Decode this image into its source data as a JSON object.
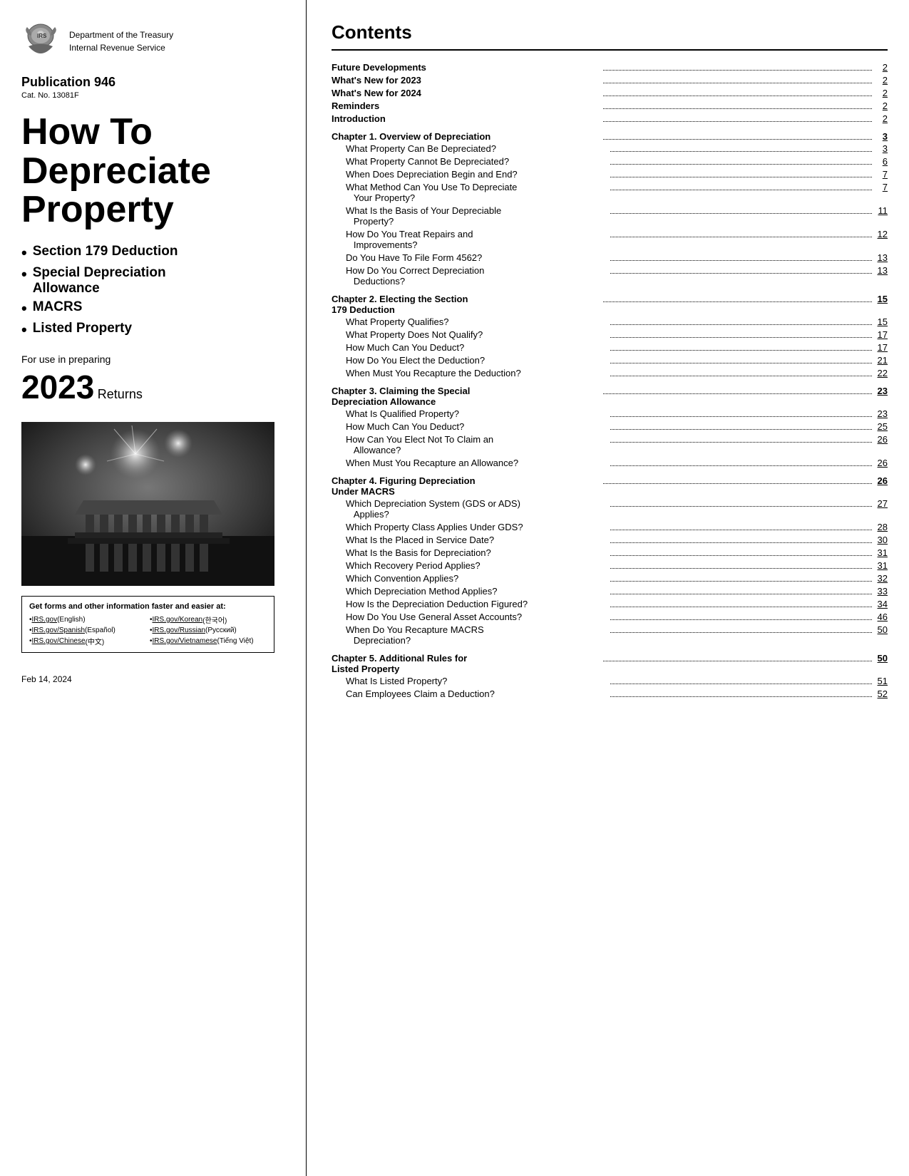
{
  "left": {
    "irs_dept": "Department of the Treasury",
    "irs_service": "Internal Revenue Service",
    "publication_label": "Publication 946",
    "cat_number": "Cat. No. 13081F",
    "main_title_line1": "How To",
    "main_title_line2": "Depreciate",
    "main_title_line3": "Property",
    "bullets": [
      "Section 179 Deduction",
      "Special Depreciation Allowance",
      "MACRS",
      "Listed Property"
    ],
    "for_use_text": "For use in preparing",
    "year": "2023",
    "returns_label": "Returns",
    "get_forms_title": "Get forms and other information faster and easier at:",
    "links": [
      {
        "label": "IRS.gov",
        "lang": "(English)"
      },
      {
        "label": "IRS.gov/Korean",
        "lang": "(한국어)"
      },
      {
        "label": "IRS.gov/Spanish",
        "lang": "(Español)"
      },
      {
        "label": "IRS.gov/Russian",
        "lang": "(Русский)"
      },
      {
        "label": "IRS.gov/Chinese",
        "lang": "(中文)"
      },
      {
        "label": "IRS.gov/Vietnamese",
        "lang": "(Tiếng Việt)"
      }
    ],
    "date_footer": "Feb 14, 2024"
  },
  "right": {
    "contents_title": "Contents",
    "toc": [
      {
        "text": "Future Developments",
        "dots": true,
        "page": "2",
        "bold": true,
        "indent": 0
      },
      {
        "text": "What's New for 2023",
        "dots": true,
        "page": "2",
        "bold": true,
        "indent": 0
      },
      {
        "text": "What's New for 2024",
        "dots": true,
        "page": "2",
        "bold": true,
        "indent": 0
      },
      {
        "text": "Reminders",
        "dots": true,
        "page": "2",
        "bold": true,
        "indent": 0
      },
      {
        "text": "Introduction",
        "dots": true,
        "page": "2",
        "bold": true,
        "indent": 0
      },
      {
        "chapter": "Chapter 1. Overview of Depreciation",
        "dots": true,
        "page": "3"
      },
      {
        "text": "What Property Can Be Depreciated?",
        "dots": true,
        "page": "3",
        "indent": 1
      },
      {
        "text": "What Property Cannot Be Depreciated?",
        "dots": true,
        "page": "6",
        "indent": 1
      },
      {
        "text": "When Does Depreciation Begin and End?",
        "dots": true,
        "page": "7",
        "indent": 1
      },
      {
        "text": "What Method Can You Use To Depreciate Your Property?",
        "dots": true,
        "page": "7",
        "indent": 1,
        "multiline": true
      },
      {
        "text": "What Is the Basis of Your Depreciable Property?",
        "dots": true,
        "page": "11",
        "indent": 1,
        "multiline": true
      },
      {
        "text": "How Do You Treat Repairs and Improvements?",
        "dots": true,
        "page": "12",
        "indent": 1,
        "multiline": true
      },
      {
        "text": "Do You Have To File Form 4562?",
        "dots": true,
        "page": "13",
        "indent": 1
      },
      {
        "text": "How Do You Correct Depreciation Deductions?",
        "dots": true,
        "page": "13",
        "indent": 1,
        "multiline": true
      },
      {
        "chapter": "Chapter 2. Electing the Section 179 Deduction",
        "dots": true,
        "page": "15"
      },
      {
        "text": "What Property Qualifies?",
        "dots": true,
        "page": "15",
        "indent": 1
      },
      {
        "text": "What Property Does Not Qualify?",
        "dots": true,
        "page": "17",
        "indent": 1
      },
      {
        "text": "How Much Can You Deduct?",
        "dots": true,
        "page": "17",
        "indent": 1
      },
      {
        "text": "How Do You Elect the Deduction?",
        "dots": true,
        "page": "21",
        "indent": 1
      },
      {
        "text": "When Must You Recapture the Deduction?",
        "dots": true,
        "page": "22",
        "indent": 1
      },
      {
        "chapter": "Chapter 3. Claiming the Special Depreciation Allowance",
        "dots": true,
        "page": "23"
      },
      {
        "text": "What Is Qualified Property?",
        "dots": true,
        "page": "23",
        "indent": 1
      },
      {
        "text": "How Much Can You Deduct?",
        "dots": true,
        "page": "25",
        "indent": 1
      },
      {
        "text": "How Can You Elect Not To Claim an Allowance?",
        "dots": true,
        "page": "26",
        "indent": 1,
        "multiline": true
      },
      {
        "text": "When Must You Recapture an Allowance?",
        "dots": true,
        "page": "26",
        "indent": 1
      },
      {
        "chapter": "Chapter 4. Figuring Depreciation Under MACRS",
        "dots": true,
        "page": "26"
      },
      {
        "text": "Which Depreciation System (GDS or ADS) Applies?",
        "dots": true,
        "page": "27",
        "indent": 1,
        "multiline": true
      },
      {
        "text": "Which Property Class Applies Under GDS?",
        "dots": true,
        "page": "28",
        "indent": 1
      },
      {
        "text": "What Is the Placed in Service Date?",
        "dots": true,
        "page": "30",
        "indent": 1
      },
      {
        "text": "What Is the Basis for Depreciation?",
        "dots": true,
        "page": "31",
        "indent": 1
      },
      {
        "text": "Which Recovery Period Applies?",
        "dots": true,
        "page": "31",
        "indent": 1
      },
      {
        "text": "Which Convention Applies?",
        "dots": true,
        "page": "32",
        "indent": 1
      },
      {
        "text": "Which Depreciation Method Applies?",
        "dots": true,
        "page": "33",
        "indent": 1
      },
      {
        "text": "How Is the Depreciation Deduction Figured?",
        "dots": true,
        "page": "34",
        "indent": 1
      },
      {
        "text": "How Do You Use General Asset Accounts?",
        "dots": true,
        "page": "46",
        "indent": 1
      },
      {
        "text": "When Do You Recapture MACRS Depreciation?",
        "dots": true,
        "page": "50",
        "indent": 1,
        "multiline": true
      },
      {
        "chapter": "Chapter 5. Additional Rules for Listed Property",
        "dots": true,
        "page": "50"
      },
      {
        "text": "What Is Listed Property?",
        "dots": true,
        "page": "51",
        "indent": 1
      },
      {
        "text": "Can Employees Claim a Deduction?",
        "dots": true,
        "page": "52",
        "indent": 1
      }
    ]
  }
}
